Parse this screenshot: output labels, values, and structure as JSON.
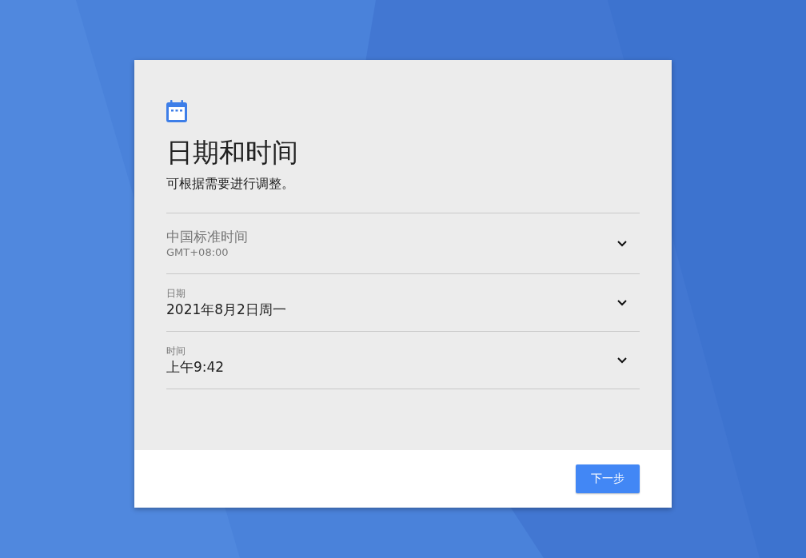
{
  "title": "日期和时间",
  "subtitle": "可根据需要进行调整。",
  "settings": [
    {
      "kind": "timezone",
      "value": "中国标准时间",
      "detail": "GMT+08:00"
    },
    {
      "kind": "labeled",
      "label": "日期",
      "value": "2021年8月2日周一"
    },
    {
      "kind": "labeled",
      "label": "时间",
      "value": "上午9:42"
    }
  ],
  "buttons": [
    "下一步"
  ]
}
